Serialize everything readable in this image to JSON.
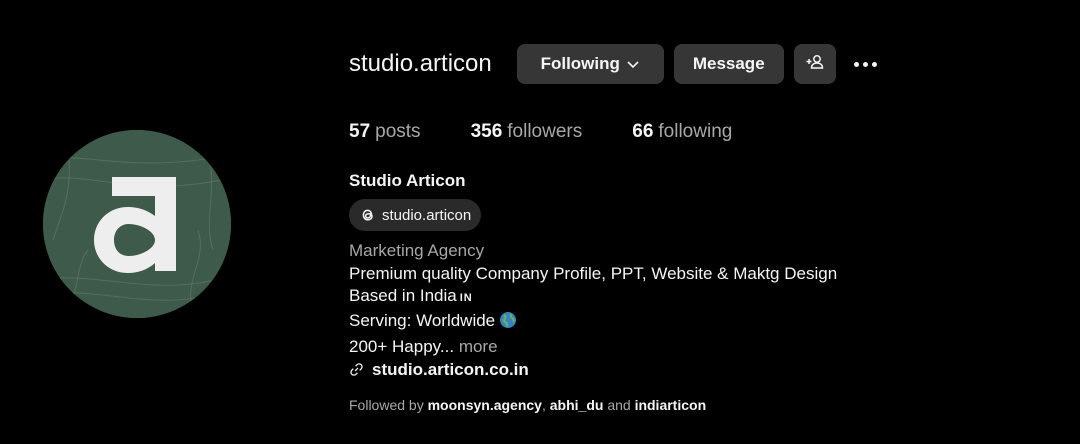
{
  "profile": {
    "username": "studio.articon",
    "full_name": "Studio Articon",
    "threads_handle": "studio.articon",
    "category": "Marketing Agency",
    "bio_line1": "Premium quality Company Profile, PPT, Website & Maktg Design",
    "bio_line2": "Based in India",
    "bio_flag": "IN",
    "bio_line3": "Serving: Worldwide",
    "bio_line4": "200+ Happy...",
    "more_label": "more",
    "website": "studio.articon.co.in"
  },
  "actions": {
    "following_label": "Following",
    "message_label": "Message"
  },
  "stats": {
    "posts_count": "57",
    "posts_label": "posts",
    "followers_count": "356",
    "followers_label": "followers",
    "following_count": "66",
    "following_label": "following"
  },
  "followed_by": {
    "prefix": "Followed by",
    "user1": "moonsyn.agency",
    "sep": ",",
    "user2": "abhi_du",
    "and": "and",
    "user3": "indiarticon"
  },
  "icons": {
    "avatar_logo": "letter-a-logo",
    "threads": "threads-icon",
    "link": "link-icon",
    "globe": "globe-icon",
    "more": "more-horizontal-icon",
    "suggest": "add-person-icon",
    "chevron": "chevron-down-icon"
  },
  "colors": {
    "background": "#000000",
    "button": "#363636",
    "muted_text": "#a8a8a8",
    "avatar_bg": "#3e5a4a"
  }
}
